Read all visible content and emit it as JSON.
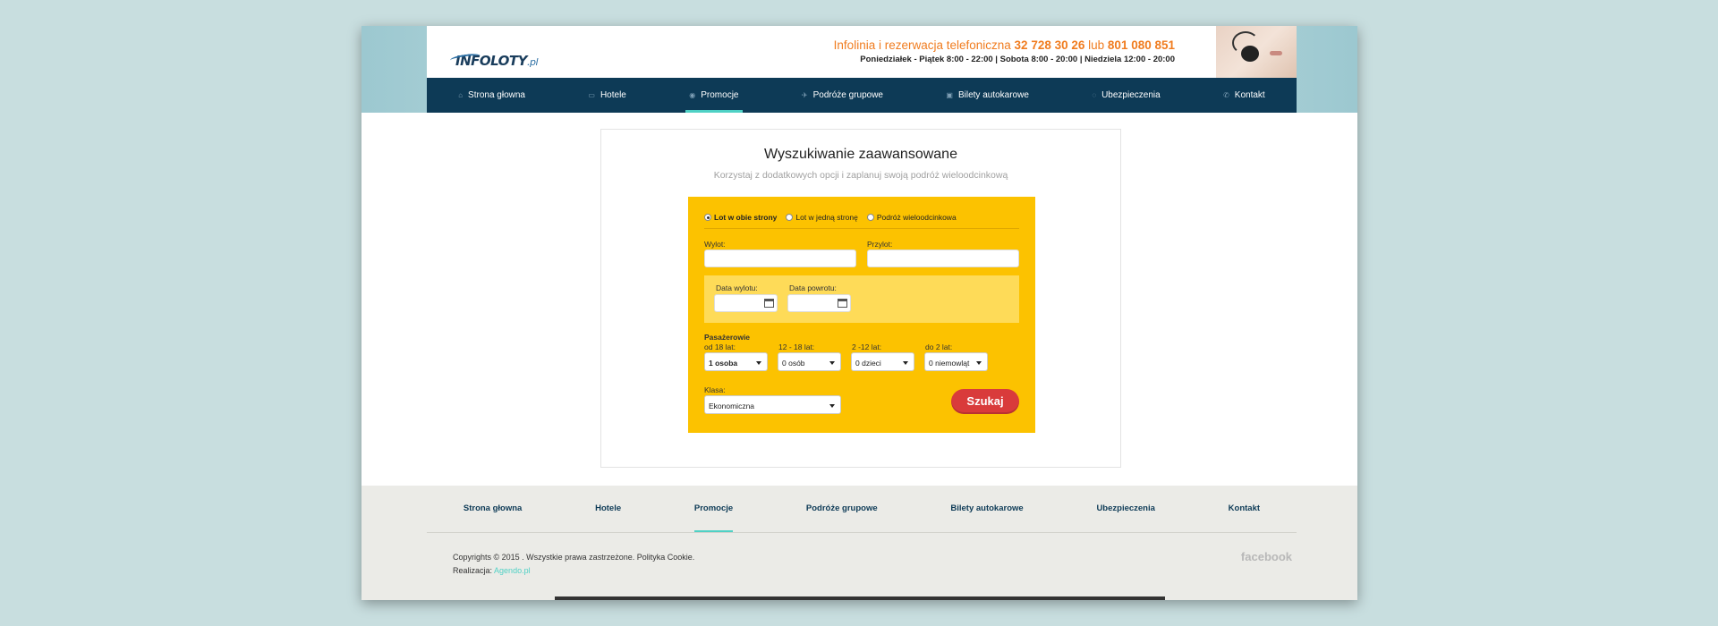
{
  "header": {
    "logo_text": "INFOLOTY",
    "logo_suffix": ".pl",
    "info_label": "Infolinia i rezerwacja telefoniczna",
    "phone1": "32 728 30 26",
    "or": "lub",
    "phone2": "801 080 851",
    "hours": "Poniedziałek - Piątek 8:00 - 22:00 | Sobota 8:00 - 20:00 | Niedziela 12:00 - 20:00"
  },
  "nav": [
    {
      "label": "Strona głowna",
      "icon": "home-icon",
      "glyph": "⌂"
    },
    {
      "label": "Hotele",
      "icon": "bed-icon",
      "glyph": "▭"
    },
    {
      "label": "Promocje",
      "icon": "percent-icon",
      "glyph": "◉",
      "active": true
    },
    {
      "label": "Podróże grupowe",
      "icon": "plane-icon",
      "glyph": "✈"
    },
    {
      "label": "Bilety autokarowe",
      "icon": "bus-icon",
      "glyph": "▣"
    },
    {
      "label": "Ubezpieczenia",
      "icon": "shield-icon",
      "glyph": "◌"
    },
    {
      "label": "Kontakt",
      "icon": "phone-icon",
      "glyph": "✆"
    }
  ],
  "search": {
    "title": "Wyszukiwanie zaawansowane",
    "subtitle": "Korzystaj z dodatkowych opcji i zaplanuj swoją podróż wieloodcinkową",
    "trip_types": [
      "Lot w obie strony",
      "Lot w jedną stronę",
      "Podróż wieloodcinkowa"
    ],
    "departure_label": "Wylot:",
    "arrival_label": "Przylot:",
    "departure_date_label": "Data wylotu:",
    "return_date_label": "Data powrotu:",
    "passengers_label": "Pasażerowie",
    "pax": [
      {
        "label": "od 18 lat:",
        "value": "1 osoba"
      },
      {
        "label": "12 - 18 lat:",
        "value": "0 osób"
      },
      {
        "label": "2 -12 lat:",
        "value": "0 dzieci"
      },
      {
        "label": "do 2 lat:",
        "value": "0 niemowląt"
      }
    ],
    "class_label": "Klasa:",
    "class_value": "Ekonomiczna",
    "submit": "Szukaj"
  },
  "footer": {
    "nav": [
      "Strona głowna",
      "Hotele",
      "Promocje",
      "Podróże grupowe",
      "Bilety autokarowe",
      "Ubezpieczenia",
      "Kontakt"
    ],
    "copyright": "Copyrights © 2015 . Wszystkie prawa zastrzeżone. Polityka Cookie.",
    "realization_label": "Realizacja:",
    "realization_link": "Agendo.pl",
    "social": "facebook"
  },
  "colors": {
    "accent": "#fcc200",
    "nav": "#0d3a56",
    "active": "#4fd1c5",
    "button": "#d93b3b"
  }
}
